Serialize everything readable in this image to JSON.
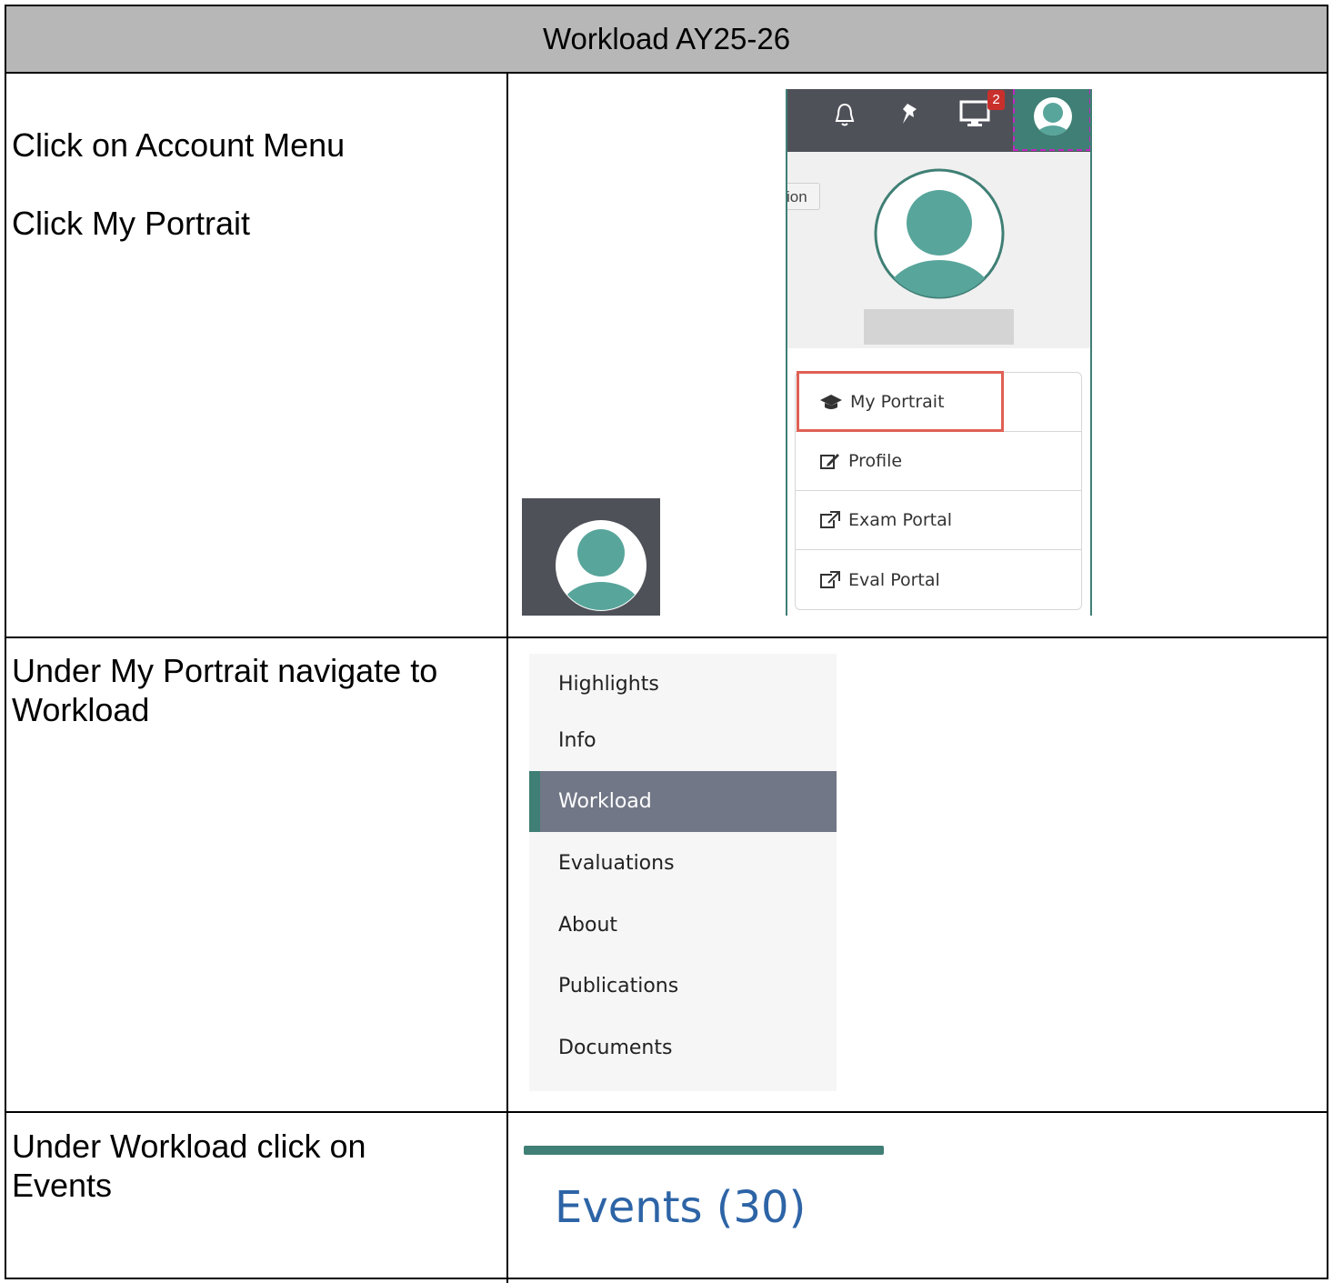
{
  "document": {
    "title": "Workload AY25-26",
    "steps": [
      {
        "lines": [
          "Click on Account Menu",
          "Click My Portrait"
        ]
      },
      {
        "lines": [
          "Under My Portrait navigate to",
          "Workload"
        ]
      },
      {
        "lines": [
          "Under Workload click on",
          "Events"
        ]
      }
    ]
  },
  "account_menu_screenshot": {
    "notification_badge": "2",
    "tooltip_fragment": "ion",
    "menu_items": [
      {
        "label": "My Portrait",
        "icon": "graduation-cap-icon"
      },
      {
        "label": "Profile",
        "icon": "edit-icon"
      },
      {
        "label": "Exam Portal",
        "icon": "external-link-icon"
      },
      {
        "label": "Eval Portal",
        "icon": "external-link-icon"
      }
    ],
    "highlight_color": "#e06055",
    "accent_color": "#3f7f75"
  },
  "portrait_nav": {
    "items": [
      "Highlights",
      "Info",
      "Workload",
      "Evaluations",
      "About",
      "Publications",
      "Documents"
    ],
    "active": "Workload"
  },
  "events_tab": {
    "label": "Events (30)",
    "color": "#2d64a6"
  }
}
